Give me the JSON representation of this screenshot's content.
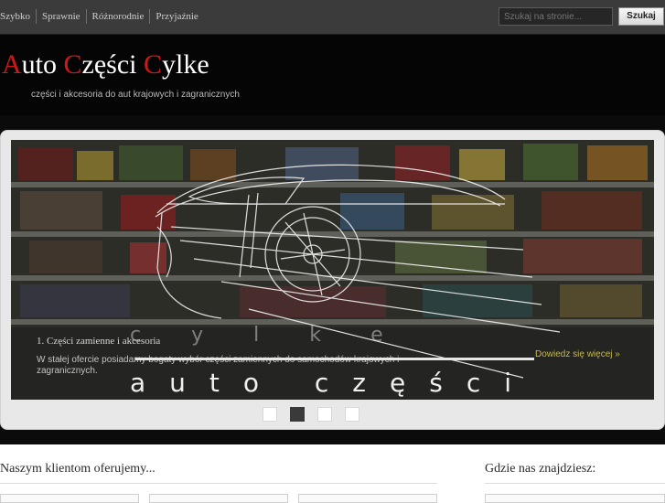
{
  "topnav": {
    "items": [
      {
        "label": "Szybko"
      },
      {
        "label": "Sprawnie"
      },
      {
        "label": "Różnorodnie"
      },
      {
        "label": "Przyjaźnie"
      }
    ]
  },
  "search": {
    "placeholder": "Szukaj na stronie...",
    "button_label": "Szukaj"
  },
  "header": {
    "logo": {
      "w1_cap": "A",
      "w1_rest": "uto",
      "w2_cap": "C",
      "w2_rest": "zęści",
      "w3_cap": "C",
      "w3_rest": "ylke"
    },
    "tagline": "części i akcesoria do aut krajowych i zagranicznych"
  },
  "slider": {
    "caption_title": "1. Części zamienne i akcesoria",
    "caption_text": "W stałej ofercie posiadamy bogaty wybór części zamiennych do samochodów krajowych i zagranicznych.",
    "more_link": "Dowiedz się więcej »",
    "slide_logo_top": "cylke",
    "slide_logo_bottom": "auto części",
    "pager": [
      "1",
      "2",
      "3",
      "4"
    ],
    "active_index": 1
  },
  "colors": {
    "logo_accent": "#d01818",
    "topbar": "#3b3b3b",
    "header": "#050505"
  },
  "sections": {
    "left_title": "Naszym klientom oferujemy...",
    "right_title": "Gdzie nas znajdziesz:"
  }
}
